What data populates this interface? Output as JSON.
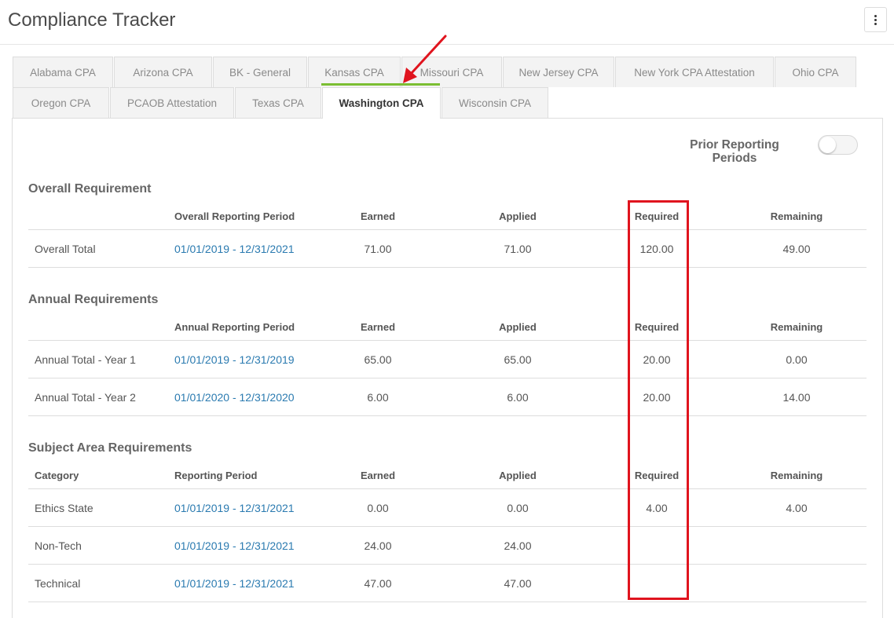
{
  "app": {
    "title": "Compliance Tracker"
  },
  "tabs": [
    {
      "label": "Alabama CPA"
    },
    {
      "label": "Arizona CPA"
    },
    {
      "label": "BK - General"
    },
    {
      "label": "Kansas CPA"
    },
    {
      "label": "Missouri CPA"
    },
    {
      "label": "New Jersey CPA"
    },
    {
      "label": "New York CPA Attestation"
    },
    {
      "label": "Ohio CPA"
    },
    {
      "label": "Oregon CPA"
    },
    {
      "label": "PCAOB Attestation"
    },
    {
      "label": "Texas CPA"
    },
    {
      "label": "Washington CPA"
    },
    {
      "label": "Wisconsin CPA"
    }
  ],
  "active_tab": "Washington CPA",
  "prior_toggle": {
    "label": "Prior Reporting Periods",
    "on": false
  },
  "overall": {
    "title": "Overall Requirement",
    "headers": {
      "period": "Overall Reporting Period",
      "earned": "Earned",
      "applied": "Applied",
      "required": "Required",
      "remaining": "Remaining"
    },
    "rows": [
      {
        "name": "Overall Total",
        "period": "01/01/2019 - 12/31/2021",
        "earned": "71.00",
        "applied": "71.00",
        "required": "120.00",
        "remaining": "49.00"
      }
    ]
  },
  "annual": {
    "title": "Annual Requirements",
    "headers": {
      "period": "Annual Reporting Period",
      "earned": "Earned",
      "applied": "Applied",
      "required": "Required",
      "remaining": "Remaining"
    },
    "rows": [
      {
        "name": "Annual Total - Year 1",
        "period": "01/01/2019 - 12/31/2019",
        "earned": "65.00",
        "applied": "65.00",
        "required": "20.00",
        "remaining": "0.00"
      },
      {
        "name": "Annual Total - Year 2",
        "period": "01/01/2020 - 12/31/2020",
        "earned": "6.00",
        "applied": "6.00",
        "required": "20.00",
        "remaining": "14.00"
      }
    ]
  },
  "subject": {
    "title": "Subject Area Requirements",
    "headers": {
      "category": "Category",
      "period": "Reporting Period",
      "earned": "Earned",
      "applied": "Applied",
      "required": "Required",
      "remaining": "Remaining"
    },
    "rows": [
      {
        "name": "Ethics State",
        "period": "01/01/2019 - 12/31/2021",
        "earned": "0.00",
        "applied": "0.00",
        "required": "4.00",
        "remaining": "4.00"
      },
      {
        "name": "Non-Tech",
        "period": "01/01/2019 - 12/31/2021",
        "earned": "24.00",
        "applied": "24.00",
        "required": "",
        "remaining": ""
      },
      {
        "name": "Technical",
        "period": "01/01/2019 - 12/31/2021",
        "earned": "47.00",
        "applied": "47.00",
        "required": "",
        "remaining": ""
      }
    ]
  },
  "annotation": {
    "highlight_color": "#e0141e",
    "accent_tab_underline": "#7bbe33",
    "link_color": "#2a7ab0"
  }
}
